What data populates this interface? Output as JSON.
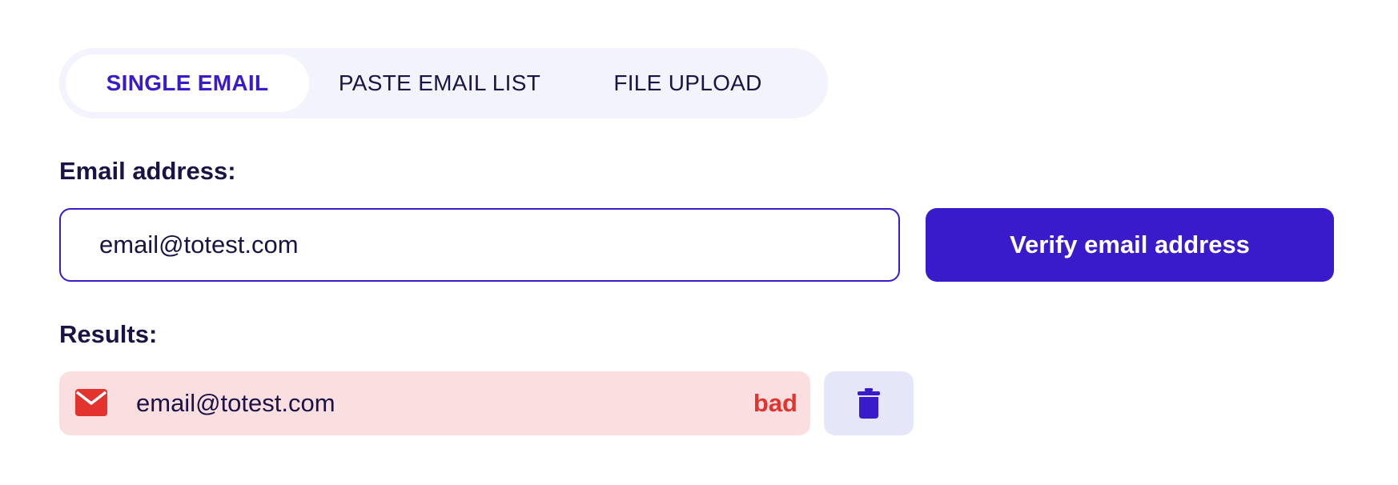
{
  "tabs": [
    {
      "label": "SINGLE EMAIL",
      "active": true
    },
    {
      "label": "PASTE EMAIL LIST",
      "active": false
    },
    {
      "label": "FILE UPLOAD",
      "active": false
    }
  ],
  "form": {
    "email_label": "Email address:",
    "email_value": "email@totest.com",
    "verify_button_label": "Verify email address"
  },
  "results": {
    "label": "Results:",
    "items": [
      {
        "email": "email@totest.com",
        "status": "bad",
        "icon": "mail-icon"
      }
    ],
    "delete_icon": "trash-icon"
  },
  "colors": {
    "accent": "#3a1bcb",
    "text": "#1a1446",
    "tab_bg": "#f2f3fc",
    "bad": "#e2332f",
    "bad_row_bg": "#fbdfe0",
    "delete_bg": "#e6e6f9"
  }
}
